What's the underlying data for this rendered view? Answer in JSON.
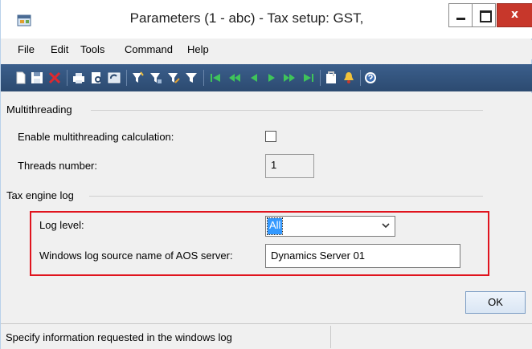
{
  "window": {
    "title": "Parameters (1 - abc) - Tax setup: GST,",
    "close_glyph": "x"
  },
  "menu": {
    "items": [
      "File",
      "Edit",
      "Tools",
      "Command",
      "Help"
    ]
  },
  "toolbar": {
    "icons": [
      "new-icon",
      "save-icon",
      "delete-icon",
      "print-icon",
      "print-preview-icon",
      "refresh-icon",
      "filter-by-selection-icon",
      "filter-by-grid-icon",
      "advanced-filter-icon",
      "remove-filter-icon",
      "first-record-icon",
      "previous-page-icon",
      "previous-record-icon",
      "next-record-icon",
      "next-page-icon",
      "last-record-icon",
      "attachments-icon",
      "alert-icon",
      "help-icon"
    ],
    "background": "#2f4e77"
  },
  "multithreading": {
    "group_title": "Multithreading",
    "enable_label": "Enable multithreading calculation:",
    "enable_checked": false,
    "threads_label": "Threads number:",
    "threads_value": "1"
  },
  "tax_engine_log": {
    "group_title": "Tax engine log",
    "log_level_label": "Log level:",
    "log_level_value": "All",
    "source_label": "Windows log source name of AOS server:",
    "source_value": "Dynamics Server 01",
    "highlight_color": "#e0141e"
  },
  "actions": {
    "ok_label": "OK"
  },
  "status": {
    "text": "Specify information requested in the windows log"
  }
}
